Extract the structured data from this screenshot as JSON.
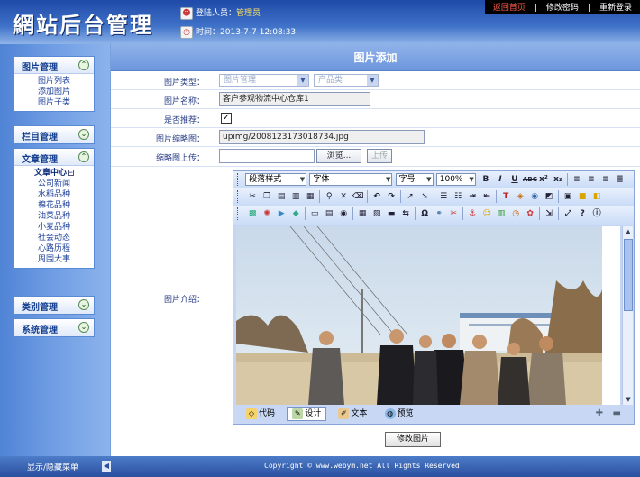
{
  "header": {
    "logo": "網站后台管理",
    "login_label": "登陆人员：",
    "login_user": "管理员",
    "time_label": "时间：",
    "time_value": "2013-7-7 12:08:33"
  },
  "topnav": {
    "items": [
      "返回首页",
      "修改密码",
      "重新登录"
    ],
    "separator": "|",
    "highlight_color": "#ff5e4c"
  },
  "sidebar": {
    "modules": [
      {
        "title": "图片管理",
        "toggle": "expanded",
        "items": [
          "图片列表",
          "添加图片",
          "图片子类"
        ]
      },
      {
        "title": "栏目管理",
        "toggle": "collapsed",
        "items": []
      },
      {
        "title": "文章管理",
        "toggle": "expanded",
        "items": [
          "文章中心",
          "公司新闻",
          "水稻品种",
          "棉花品种",
          "油菜品种",
          "小麦品种",
          "社会动态",
          "心路历程",
          "周围大事"
        ]
      },
      {
        "title": "类别管理",
        "toggle": "collapsed",
        "items": []
      },
      {
        "title": "系统管理",
        "toggle": "collapsed",
        "items": []
      }
    ]
  },
  "page": {
    "title": "图片添加",
    "fields": {
      "type_label": "图片类型：",
      "type_select_1": "图片管理",
      "type_select_2": "产品类",
      "name_label": "图片名称：",
      "name_value": "客户参观物流中心仓库1",
      "recommend_label": "是否推荐：",
      "recommend_checked": true,
      "thumb_label": "图片缩略图：",
      "thumb_value": "upimg/2008123173018734.jpg",
      "upload_label": "缩略图上传：",
      "browse_label": "浏览...",
      "upload_button": "上传",
      "intro_label": "图片介绍："
    },
    "editor": {
      "format_select": "段落样式",
      "font_select": "字体",
      "size_select": "字号",
      "zoom_select": "100%",
      "modes": [
        "代码",
        "设计",
        "文本",
        "预览"
      ],
      "active_mode": "设计"
    },
    "save_button": "修改图片"
  },
  "footer": {
    "menu_toggle": "显示/隐藏菜单",
    "copyright": "Copyright © www.webym.net All Rights Reserved"
  }
}
